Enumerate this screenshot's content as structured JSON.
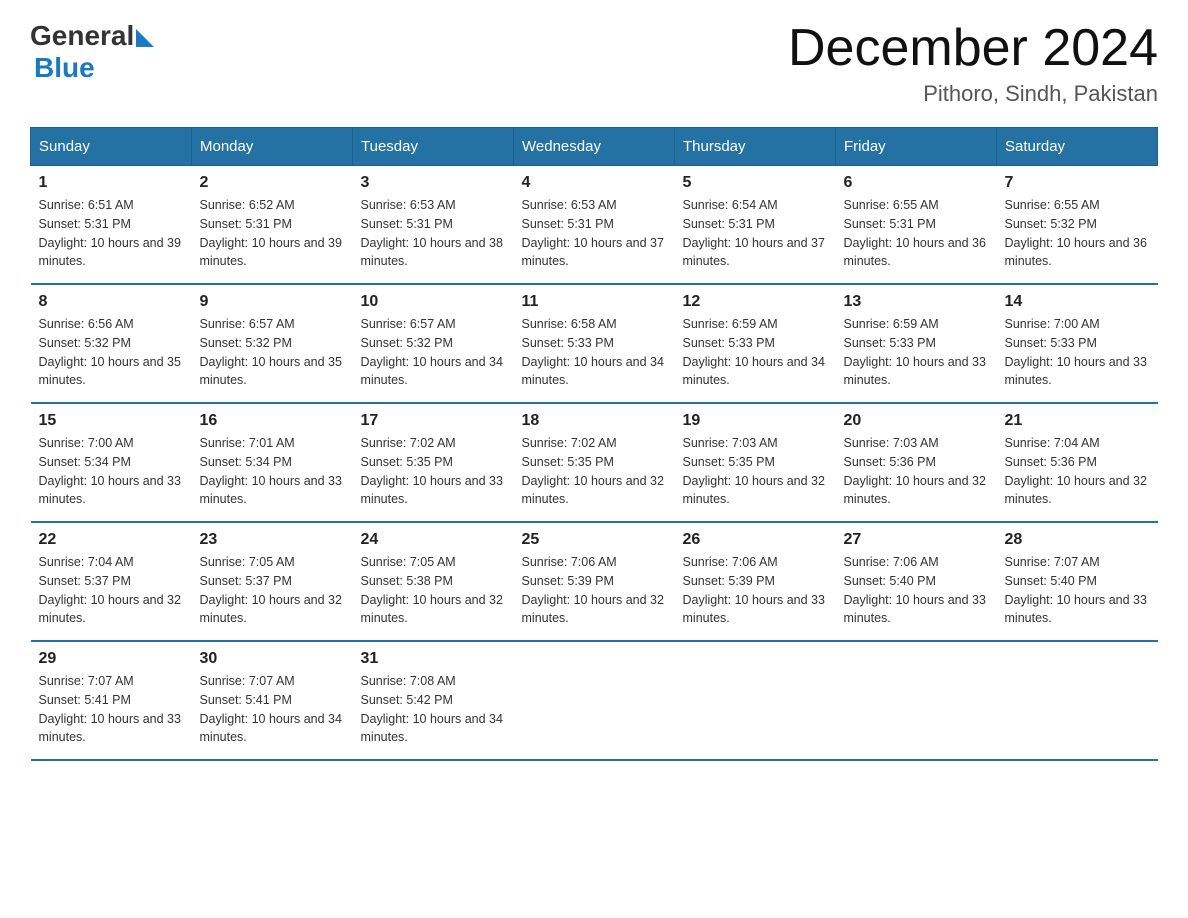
{
  "header": {
    "logo_general": "General",
    "logo_blue": "Blue",
    "month_title": "December 2024",
    "location": "Pithoro, Sindh, Pakistan"
  },
  "columns": [
    "Sunday",
    "Monday",
    "Tuesday",
    "Wednesday",
    "Thursday",
    "Friday",
    "Saturday"
  ],
  "weeks": [
    [
      {
        "day": "1",
        "sunrise": "6:51 AM",
        "sunset": "5:31 PM",
        "daylight": "10 hours and 39 minutes."
      },
      {
        "day": "2",
        "sunrise": "6:52 AM",
        "sunset": "5:31 PM",
        "daylight": "10 hours and 39 minutes."
      },
      {
        "day": "3",
        "sunrise": "6:53 AM",
        "sunset": "5:31 PM",
        "daylight": "10 hours and 38 minutes."
      },
      {
        "day": "4",
        "sunrise": "6:53 AM",
        "sunset": "5:31 PM",
        "daylight": "10 hours and 37 minutes."
      },
      {
        "day": "5",
        "sunrise": "6:54 AM",
        "sunset": "5:31 PM",
        "daylight": "10 hours and 37 minutes."
      },
      {
        "day": "6",
        "sunrise": "6:55 AM",
        "sunset": "5:31 PM",
        "daylight": "10 hours and 36 minutes."
      },
      {
        "day": "7",
        "sunrise": "6:55 AM",
        "sunset": "5:32 PM",
        "daylight": "10 hours and 36 minutes."
      }
    ],
    [
      {
        "day": "8",
        "sunrise": "6:56 AM",
        "sunset": "5:32 PM",
        "daylight": "10 hours and 35 minutes."
      },
      {
        "day": "9",
        "sunrise": "6:57 AM",
        "sunset": "5:32 PM",
        "daylight": "10 hours and 35 minutes."
      },
      {
        "day": "10",
        "sunrise": "6:57 AM",
        "sunset": "5:32 PM",
        "daylight": "10 hours and 34 minutes."
      },
      {
        "day": "11",
        "sunrise": "6:58 AM",
        "sunset": "5:33 PM",
        "daylight": "10 hours and 34 minutes."
      },
      {
        "day": "12",
        "sunrise": "6:59 AM",
        "sunset": "5:33 PM",
        "daylight": "10 hours and 34 minutes."
      },
      {
        "day": "13",
        "sunrise": "6:59 AM",
        "sunset": "5:33 PM",
        "daylight": "10 hours and 33 minutes."
      },
      {
        "day": "14",
        "sunrise": "7:00 AM",
        "sunset": "5:33 PM",
        "daylight": "10 hours and 33 minutes."
      }
    ],
    [
      {
        "day": "15",
        "sunrise": "7:00 AM",
        "sunset": "5:34 PM",
        "daylight": "10 hours and 33 minutes."
      },
      {
        "day": "16",
        "sunrise": "7:01 AM",
        "sunset": "5:34 PM",
        "daylight": "10 hours and 33 minutes."
      },
      {
        "day": "17",
        "sunrise": "7:02 AM",
        "sunset": "5:35 PM",
        "daylight": "10 hours and 33 minutes."
      },
      {
        "day": "18",
        "sunrise": "7:02 AM",
        "sunset": "5:35 PM",
        "daylight": "10 hours and 32 minutes."
      },
      {
        "day": "19",
        "sunrise": "7:03 AM",
        "sunset": "5:35 PM",
        "daylight": "10 hours and 32 minutes."
      },
      {
        "day": "20",
        "sunrise": "7:03 AM",
        "sunset": "5:36 PM",
        "daylight": "10 hours and 32 minutes."
      },
      {
        "day": "21",
        "sunrise": "7:04 AM",
        "sunset": "5:36 PM",
        "daylight": "10 hours and 32 minutes."
      }
    ],
    [
      {
        "day": "22",
        "sunrise": "7:04 AM",
        "sunset": "5:37 PM",
        "daylight": "10 hours and 32 minutes."
      },
      {
        "day": "23",
        "sunrise": "7:05 AM",
        "sunset": "5:37 PM",
        "daylight": "10 hours and 32 minutes."
      },
      {
        "day": "24",
        "sunrise": "7:05 AM",
        "sunset": "5:38 PM",
        "daylight": "10 hours and 32 minutes."
      },
      {
        "day": "25",
        "sunrise": "7:06 AM",
        "sunset": "5:39 PM",
        "daylight": "10 hours and 32 minutes."
      },
      {
        "day": "26",
        "sunrise": "7:06 AM",
        "sunset": "5:39 PM",
        "daylight": "10 hours and 33 minutes."
      },
      {
        "day": "27",
        "sunrise": "7:06 AM",
        "sunset": "5:40 PM",
        "daylight": "10 hours and 33 minutes."
      },
      {
        "day": "28",
        "sunrise": "7:07 AM",
        "sunset": "5:40 PM",
        "daylight": "10 hours and 33 minutes."
      }
    ],
    [
      {
        "day": "29",
        "sunrise": "7:07 AM",
        "sunset": "5:41 PM",
        "daylight": "10 hours and 33 minutes."
      },
      {
        "day": "30",
        "sunrise": "7:07 AM",
        "sunset": "5:41 PM",
        "daylight": "10 hours and 34 minutes."
      },
      {
        "day": "31",
        "sunrise": "7:08 AM",
        "sunset": "5:42 PM",
        "daylight": "10 hours and 34 minutes."
      },
      null,
      null,
      null,
      null
    ]
  ],
  "labels": {
    "sunrise_prefix": "Sunrise: ",
    "sunset_prefix": "Sunset: ",
    "daylight_prefix": "Daylight: "
  }
}
